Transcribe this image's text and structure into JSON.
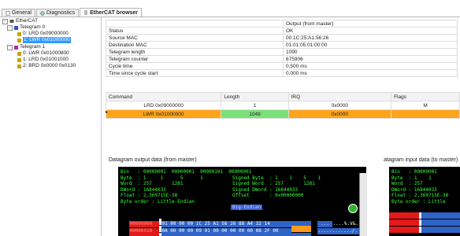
{
  "tabs": [
    {
      "label": "General",
      "icon": "document-icon",
      "active": false
    },
    {
      "label": "Diagnostics",
      "icon": "diagnostics-icon",
      "active": false
    },
    {
      "label": "EtherCAT browser",
      "icon": "ethercat-icon",
      "active": true
    }
  ],
  "tree": {
    "root": "EtherCAT",
    "telegram0": "Telegram 0",
    "t0_items": [
      "0: LRD 0x09000000",
      "1: LWR 0x01000000"
    ],
    "telegram1": "Telegram 1",
    "t1_items": [
      "0: LWR 0x01000800",
      "1: LRD 0x01001000",
      "2: BRD 0x0000 0x0130"
    ]
  },
  "props": {
    "header": "Output (from master)",
    "rows": [
      {
        "label": "Status",
        "value": "OK"
      },
      {
        "label": "Source MAC",
        "value": "00:1C:25:A1:56:26"
      },
      {
        "label": "Destination MAC",
        "value": "01:01:05:01:00:00"
      },
      {
        "label": "Telegram length",
        "value": "1090"
      },
      {
        "label": "Telegram counter",
        "value": "675906"
      },
      {
        "label": "Cycle time",
        "value": "0,500 ms"
      },
      {
        "label": "Time since cycle start",
        "value": "0,000 ms"
      }
    ]
  },
  "commands": {
    "headers": [
      "Command",
      "Length",
      "IRQ",
      "Flags"
    ],
    "rows": [
      {
        "command": "LRD 0x09000000",
        "length": "1",
        "irq": "0x0000",
        "flags": "M"
      },
      {
        "command": "LWR 0x01000000",
        "length": "1049",
        "irq": "0x0000",
        "flags": ""
      }
    ]
  },
  "datagram_out": {
    "title": "Datagram output data (from master)",
    "lines": [
      "Bin   : 00000001  00000001  00000101  00000001",
      "Byte  : 1     1      5      1",
      "Word  : 257       1281",
      "DWord : 16844033",
      "Float : 2,369715E-38"
    ],
    "signed_lines": [
      "Signed Byte  : 1    1    5    1",
      "Signed Word  : 257       1281",
      "Signed DWord : 16844033",
      "Offset       : 0x00000000"
    ],
    "byte_order_label": "Byte order :",
    "byte_order_value": "Little-Endian",
    "big_endian": "Big-Endian",
    "hex_rows": [
      {
        "addr": "00000000",
        "bytes": "01 00 00 00 1C 25 A1 56 26 88 A4 32 14",
        "ascii": "....%.V&..2."
      },
      {
        "addr": "00000010",
        "bytes": "0A 00 00 00 09 01 00 00 00 00 00 08 2F 00",
        "ascii": "............/."
      }
    ]
  },
  "datagram_in": {
    "title": "atagram input data (to master)",
    "lines": [
      "Bin   : 00000001",
      "Byte  : 1    1",
      "Word  : 257",
      "DWord : 16844033",
      "Float : 2,369715E-38"
    ],
    "byte_order_label": "Byte order :",
    "byte_order_value": "Little"
  }
}
